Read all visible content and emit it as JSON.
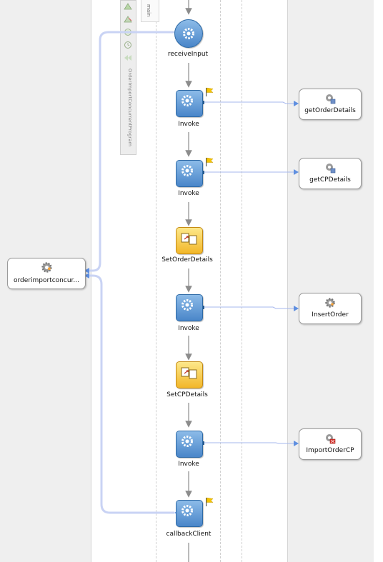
{
  "scope": {
    "name": "OrderImportConcurrentProgram",
    "main_tab": "main"
  },
  "client_partner": {
    "label": "orderimportconcur...",
    "icon": "gear-icon"
  },
  "activities": [
    {
      "label": "receiveInput",
      "type": "receive",
      "icon": "gear-icon"
    },
    {
      "label": "Invoke",
      "type": "invoke",
      "icon": "gear-icon",
      "flag": true,
      "partner": "getOrderDetails"
    },
    {
      "label": "Invoke",
      "type": "invoke",
      "icon": "gear-icon",
      "flag": true,
      "partner": "getCPDetails"
    },
    {
      "label": "SetOrderDetails",
      "type": "assign",
      "icon": "assign-icon"
    },
    {
      "label": "Invoke",
      "type": "invoke",
      "icon": "gear-icon",
      "flag": false,
      "partner": "InsertOrder"
    },
    {
      "label": "SetCPDetails",
      "type": "assign",
      "icon": "assign-icon"
    },
    {
      "label": "Invoke",
      "type": "invoke",
      "icon": "gear-icon",
      "flag": false,
      "partner": "ImportOrderCP"
    },
    {
      "label": "callbackClient",
      "type": "invoke",
      "icon": "gear-icon",
      "flag": true
    }
  ],
  "partners": [
    {
      "label": "getOrderDetails",
      "icon": "db-adapter-icon"
    },
    {
      "label": "getCPDetails",
      "icon": "db-adapter-icon"
    },
    {
      "label": "InsertOrder",
      "icon": "gear-icon"
    },
    {
      "label": "ImportOrderCP",
      "icon": "db-error-icon"
    }
  ],
  "colors": {
    "link": "#a9b8f0",
    "flow_arrow": "#8c8c8c",
    "invoke_fill": "#4a86c9",
    "assign_fill": "#f2b72a",
    "flag": "#f5c400"
  }
}
